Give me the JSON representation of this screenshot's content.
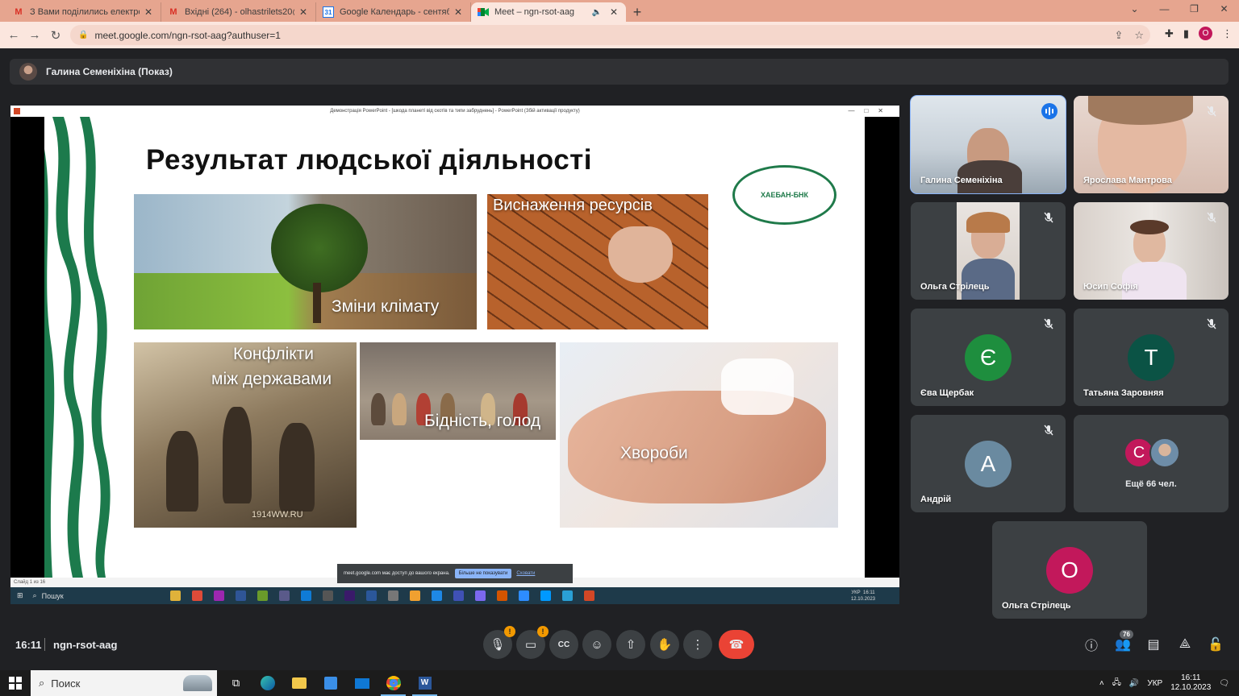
{
  "browser": {
    "tabs": [
      {
        "title": "З Вами поділились електронною",
        "favicon": "gmail-icon",
        "active": false
      },
      {
        "title": "Вхідні (264) - olhastrilets20@gm",
        "favicon": "gmail-icon",
        "active": false
      },
      {
        "title": "Google Календарь - сентябрь 2",
        "favicon": "calendar-icon",
        "active": false
      },
      {
        "title": "Meet – ngn-rsot-aag",
        "favicon": "meet-icon",
        "active": true
      }
    ],
    "url": "meet.google.com/ngn-rsot-aag?authuser=1",
    "profile_initial": "О"
  },
  "presenter": {
    "label": "Галина Семеніхіна (Показ)"
  },
  "shared_screen": {
    "ppt_window_title": "Демонстрація PowerPoint - [шкода планеті від скотів та типи забруднень] - PowerPoint (Збій активації продукту)",
    "slide_title": "Результат людської діяльності",
    "logo_text": "ХАЕБАН-БНК",
    "captions": {
      "climate": "Зміни клімату",
      "resources": "Виснаження ресурсів",
      "conflicts_1": "Конфлікти",
      "conflicts_2": "між державами",
      "poverty": "Бідність, голод",
      "disease": "Хвороби",
      "watermark": "1914WW.RU"
    },
    "status_text": "Слайд 1 из 16",
    "notice_text": "meet.google.com має доступ до вашого екрана.",
    "notice_button": "Більше не показувати",
    "notice_link": "Сховати",
    "inner_search": "Пошук",
    "inner_lang": "УКР",
    "inner_time": "16:11",
    "inner_date": "12.10.2023"
  },
  "participants": [
    {
      "name": "Галина Семеніхіна",
      "type": "video",
      "speaking": true,
      "muted": false
    },
    {
      "name": "Ярослава Мантрова",
      "type": "video",
      "speaking": false,
      "muted": true
    },
    {
      "name": "Ольга Стрілець",
      "type": "video",
      "speaking": false,
      "muted": true
    },
    {
      "name": "Юсип Софія",
      "type": "video",
      "speaking": false,
      "muted": true
    },
    {
      "name": "Єва Щербак",
      "initial": "Є",
      "color": "#1e8e3e",
      "muted": true
    },
    {
      "name": "Татьяна Заровняя",
      "initial": "Т",
      "color": "#0b5345",
      "muted": true
    },
    {
      "name": "Андрій",
      "initial": "А",
      "color": "#6a8aa0",
      "muted": true
    },
    {
      "name": "Ольга Стрілець",
      "initial": "О",
      "color": "#c2185b",
      "muted": false
    }
  ],
  "more_tile": {
    "initial": "С",
    "label": "Ещё 66 чел."
  },
  "meeting": {
    "time": "16:11",
    "code": "ngn-rsot-aag",
    "participant_count": "76",
    "warn_mark": "!"
  },
  "taskbar": {
    "search_placeholder": "Поиск",
    "lang": "УКР",
    "time": "16:11",
    "date": "12.10.2023"
  },
  "colors": {
    "meet_bg": "#202124",
    "tile_bg": "#3c4043",
    "accent": "#8ab4f8",
    "hangup": "#ea4335",
    "tab_bar": "#e6a58f"
  }
}
